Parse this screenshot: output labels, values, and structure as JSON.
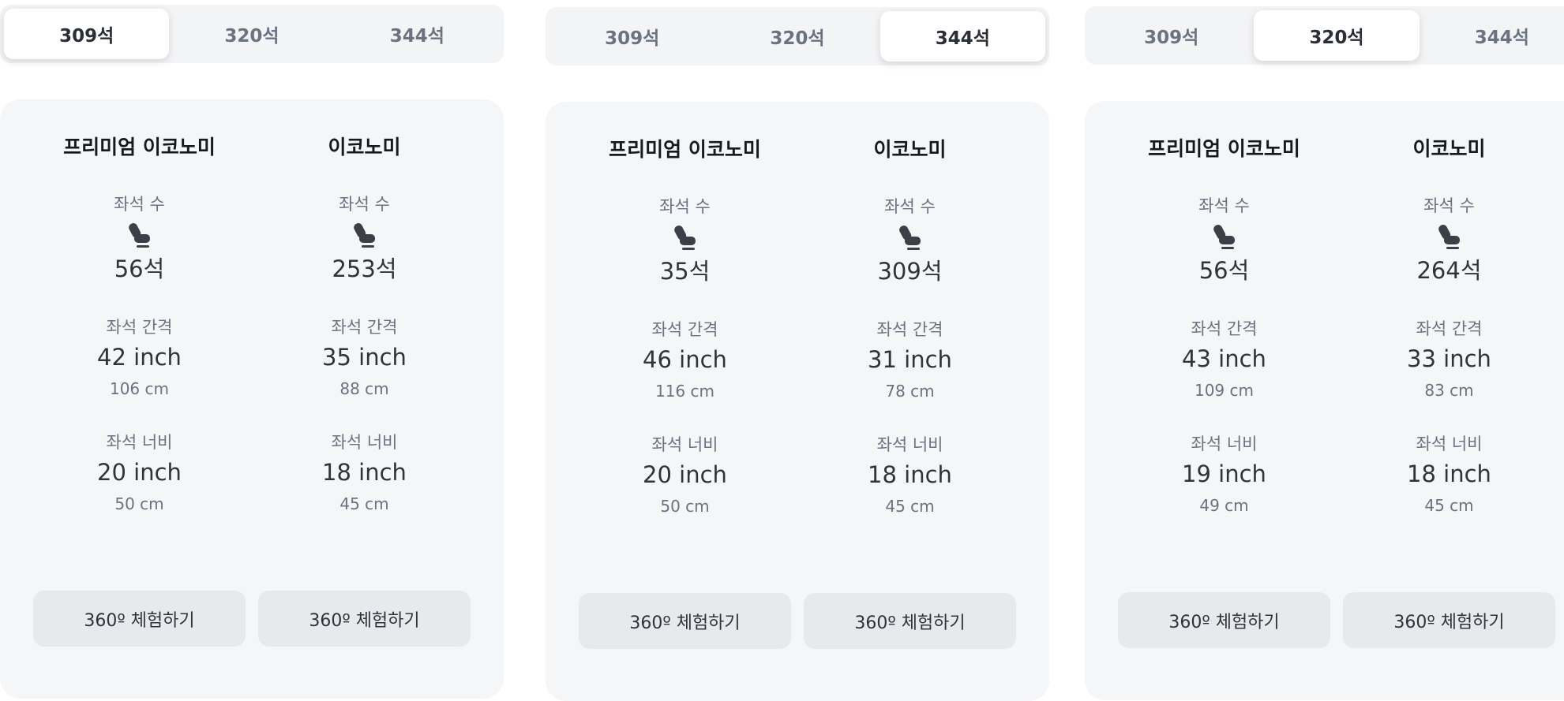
{
  "panels": [
    {
      "tabs": [
        "309석",
        "320석",
        "344석"
      ],
      "active_tab": 0,
      "columns": [
        {
          "class_name": "프리미엄 이코노미",
          "seats_label": "좌석 수",
          "seats": "56석",
          "pitch_label": "좌석 간격",
          "pitch": "42 inch",
          "pitch_cm": "106 cm",
          "width_label": "좌석 너비",
          "width": "20 inch",
          "width_cm": "50 cm",
          "button": "360º 체험하기"
        },
        {
          "class_name": "이코노미",
          "seats_label": "좌석 수",
          "seats": "253석",
          "pitch_label": "좌석 간격",
          "pitch": "35 inch",
          "pitch_cm": "88 cm",
          "width_label": "좌석 너비",
          "width": "18 inch",
          "width_cm": "45 cm",
          "button": "360º 체험하기"
        }
      ]
    },
    {
      "tabs": [
        "309석",
        "320석",
        "344석"
      ],
      "active_tab": 2,
      "columns": [
        {
          "class_name": "프리미엄 이코노미",
          "seats_label": "좌석 수",
          "seats": "35석",
          "pitch_label": "좌석 간격",
          "pitch": "46 inch",
          "pitch_cm": "116 cm",
          "width_label": "좌석 너비",
          "width": "20 inch",
          "width_cm": "50 cm",
          "button": "360º 체험하기"
        },
        {
          "class_name": "이코노미",
          "seats_label": "좌석 수",
          "seats": "309석",
          "pitch_label": "좌석 간격",
          "pitch": "31 inch",
          "pitch_cm": "78 cm",
          "width_label": "좌석 너비",
          "width": "18 inch",
          "width_cm": "45 cm",
          "button": "360º 체험하기"
        }
      ]
    },
    {
      "tabs": [
        "309석",
        "320석",
        "344석"
      ],
      "active_tab": 1,
      "columns": [
        {
          "class_name": "프리미엄 이코노미",
          "seats_label": "좌석 수",
          "seats": "56석",
          "pitch_label": "좌석 간격",
          "pitch": "43 inch",
          "pitch_cm": "109 cm",
          "width_label": "좌석 너비",
          "width": "19 inch",
          "width_cm": "49 cm",
          "button": "360º 체험하기"
        },
        {
          "class_name": "이코노미",
          "seats_label": "좌석 수",
          "seats": "264석",
          "pitch_label": "좌석 간격",
          "pitch": "33 inch",
          "pitch_cm": "83 cm",
          "width_label": "좌석 너비",
          "width": "18 inch",
          "width_cm": "45 cm",
          "button": "360º 체험하기"
        }
      ]
    }
  ],
  "icons": {
    "seat": "seat-icon"
  },
  "colors": {
    "tab_active_bg": "#ffffff",
    "tab_bar_bg": "#f3f4f6",
    "card_bg": "#f5f6f8",
    "button_bg": "#e7e9ec",
    "icon": "#3b4048"
  }
}
